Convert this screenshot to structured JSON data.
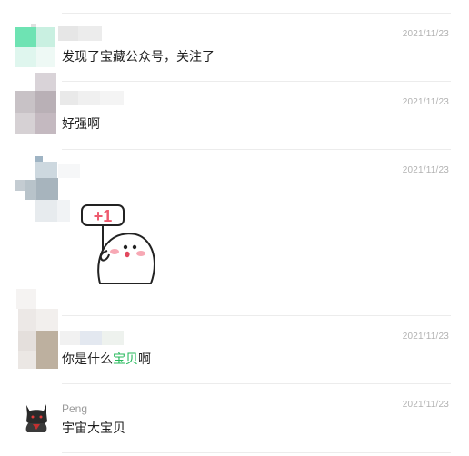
{
  "comments": [
    {
      "id": "c1",
      "author": "",
      "date": "2021/11/23",
      "text": "发现了宝藏公众号，关注了"
    },
    {
      "id": "c2",
      "author": "",
      "date": "2021/11/23",
      "text": "好强啊"
    },
    {
      "id": "c3",
      "author": "",
      "date": "2021/11/23",
      "text": "",
      "sticker": {
        "caption": "+1",
        "icon": "plus-one-sticker"
      }
    },
    {
      "id": "c4",
      "author": "",
      "date": "2021/11/23",
      "text_parts": [
        "你是什么",
        "宝贝",
        "啊"
      ]
    },
    {
      "id": "c5",
      "author": "Peng",
      "date": "2021/11/23",
      "text": "宇宙大宝贝",
      "avatar_icon": "black-cat-avatar-icon"
    }
  ],
  "colors": {
    "highlight": "#24b85a",
    "date": "#b2b2b2",
    "name": "#9a9a9a",
    "divider": "#ececec"
  }
}
